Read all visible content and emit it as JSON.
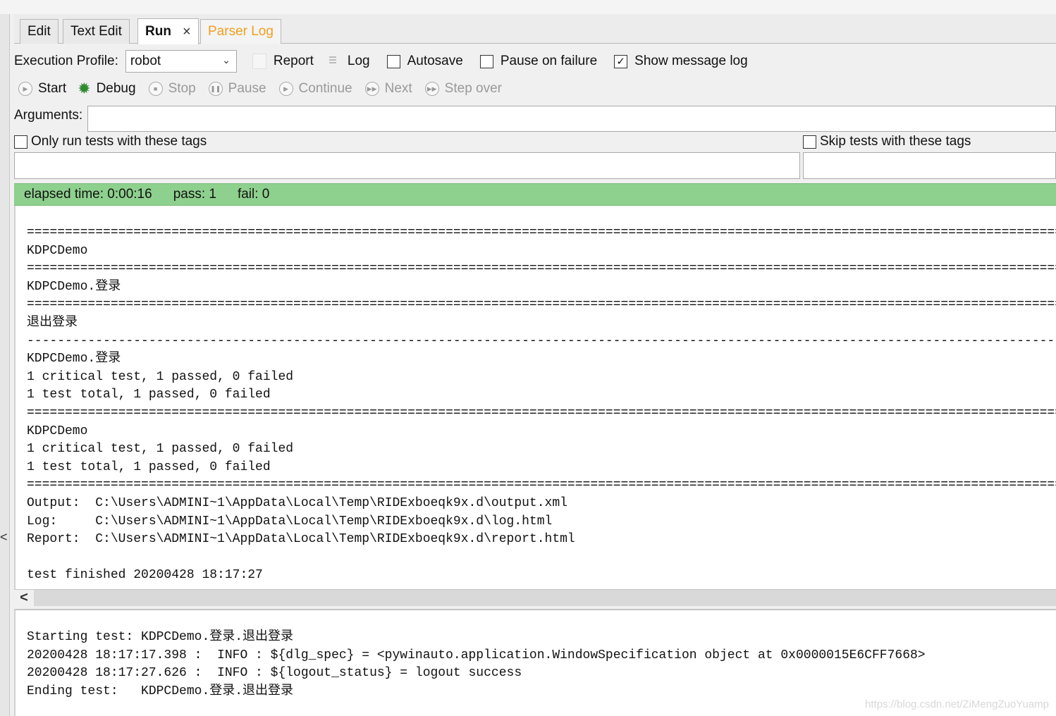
{
  "tabs": [
    {
      "label": "Edit"
    },
    {
      "label": "Text Edit"
    },
    {
      "label": "Run",
      "close": "×"
    },
    {
      "label": "Parser Log"
    }
  ],
  "toolbar": {
    "execution_profile_label": "Execution Profile:",
    "execution_profile_value": "robot",
    "report_label": "Report",
    "log_label": "Log",
    "autosave_label": "Autosave",
    "pause_on_failure_label": "Pause on failure",
    "show_message_log_label": "Show message log",
    "show_message_log_checked": "✓"
  },
  "controls": {
    "start": "Start",
    "debug": "Debug",
    "stop": "Stop",
    "pause": "Pause",
    "continue": "Continue",
    "next": "Next",
    "step_over": "Step over"
  },
  "arguments": {
    "label": "Arguments:",
    "value": ""
  },
  "tags": {
    "only_run_label": "Only run tests with these tags",
    "skip_label": "Skip tests with these tags"
  },
  "status": {
    "elapsed": "elapsed time: 0:00:16",
    "pass": "pass: 1",
    "fail": "fail: 0"
  },
  "output_lines": [
    "==============================================================================================================================================================",
    "KDPCDemo",
    "==============================================================================================================================================================",
    "KDPCDemo.登录",
    "==============================================================================================================================================================",
    "退出登录",
    "--------------------------------------------------------------------------------------------------------------------------------------------------------------",
    "KDPCDemo.登录",
    "1 critical test, 1 passed, 0 failed",
    "1 test total, 1 passed, 0 failed",
    "==============================================================================================================================================================",
    "KDPCDemo",
    "1 critical test, 1 passed, 0 failed",
    "1 test total, 1 passed, 0 failed",
    "==============================================================================================================================================================",
    "Output:  C:\\Users\\ADMINI~1\\AppData\\Local\\Temp\\RIDExboeqk9x.d\\output.xml",
    "Log:     C:\\Users\\ADMINI~1\\AppData\\Local\\Temp\\RIDExboeqk9x.d\\log.html",
    "Report:  C:\\Users\\ADMINI~1\\AppData\\Local\\Temp\\RIDExboeqk9x.d\\report.html",
    "",
    "test finished 20200428 18:17:27"
  ],
  "message_lines": [
    "Starting test: KDPCDemo.登录.退出登录",
    "20200428 18:17:17.398 :  INFO : ${dlg_spec} = <pywinauto.application.WindowSpecification object at 0x0000015E6CFF7668>",
    "20200428 18:17:27.626 :  INFO : ${logout_status} = logout success",
    "Ending test:   KDPCDemo.登录.退出登录"
  ],
  "scroll_left_glyph": "<",
  "left_edge_glyph": "<",
  "watermark": "https://blog.csdn.net/ZiMengZuoYuamp"
}
